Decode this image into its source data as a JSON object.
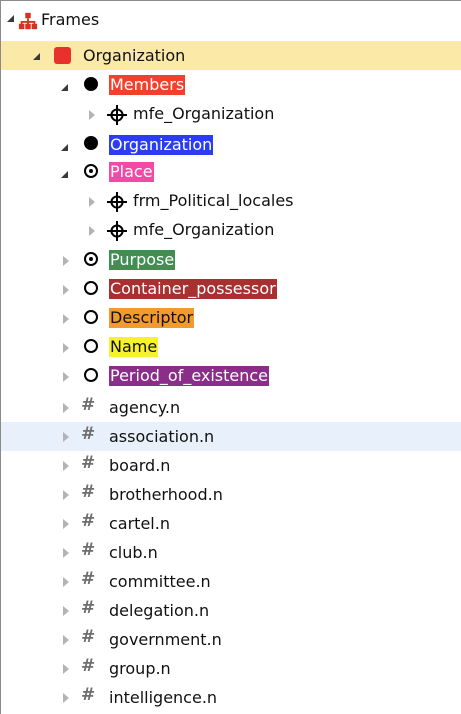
{
  "colors": {
    "selected_bg": "#fbe9a7",
    "hover_bg": "#e8f0fb",
    "members": "#f2402d",
    "organization": "#2a3df2",
    "place": "#f24aa6",
    "purpose": "#3f8f52",
    "container_possessor": "#a83030",
    "descriptor": "#f39b2a",
    "name": "#f6f230",
    "period_of_existence": "#8a2e8a"
  },
  "tree": {
    "root": {
      "label": "Frames",
      "icon": "frames-hierarchy-icon"
    },
    "frame": {
      "label": "Organization",
      "icon": "red-square-icon"
    },
    "core_elements": [
      {
        "label": "Members",
        "icon": "filled-circle-icon",
        "child": "mfe_Organization"
      },
      {
        "label": "Organization",
        "icon": "filled-circle-icon"
      },
      {
        "label": "Place",
        "icon": "circle-dot-icon",
        "children": [
          "frm_Political_locales",
          "mfe_Organization"
        ]
      }
    ],
    "other_elements": [
      {
        "label": "Purpose",
        "icon": "circle-dot-icon"
      },
      {
        "label": "Container_possessor",
        "icon": "hollow-circle-icon"
      },
      {
        "label": "Descriptor",
        "icon": "hollow-circle-icon"
      },
      {
        "label": "Name",
        "icon": "hollow-circle-icon"
      },
      {
        "label": "Period_of_existence",
        "icon": "hollow-circle-icon"
      }
    ],
    "lexical_units": [
      "agency.n",
      "association.n",
      "board.n",
      "brotherhood.n",
      "cartel.n",
      "club.n",
      "committee.n",
      "delegation.n",
      "government.n",
      "group.n",
      "intelligence.n"
    ]
  }
}
